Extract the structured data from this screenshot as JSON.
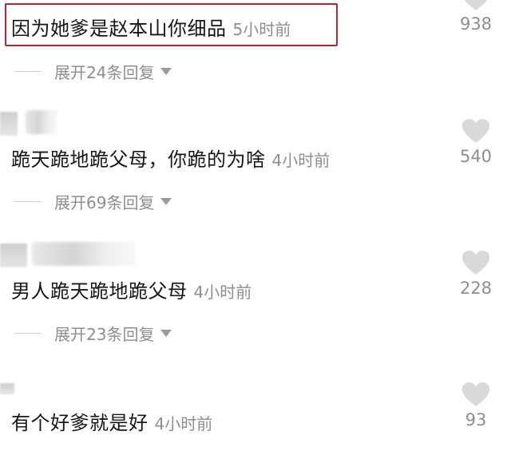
{
  "comments": [
    {
      "text": "因为她爹是赵本山你细品",
      "time": "5小时前",
      "likes": "938",
      "highlighted": true,
      "expand_label": "展开24条回复"
    },
    {
      "text": "跪天跪地跪父母，你跪的为啥",
      "time": "4小时前",
      "likes": "540",
      "expand_label": "展开69条回复"
    },
    {
      "text": "男人跪天跪地跪父母",
      "time": "4小时前",
      "likes": "228",
      "expand_label": "展开23条回复"
    },
    {
      "text": "有个好爹就是好",
      "time": "4小时前",
      "likes": "93"
    }
  ],
  "icons": {
    "like": "heart-icon",
    "expand": "caret-down-icon"
  },
  "colors": {
    "highlight_border": "#b3262b",
    "secondary_text": "#8e8e8e",
    "heart": "#d9d9d9"
  }
}
